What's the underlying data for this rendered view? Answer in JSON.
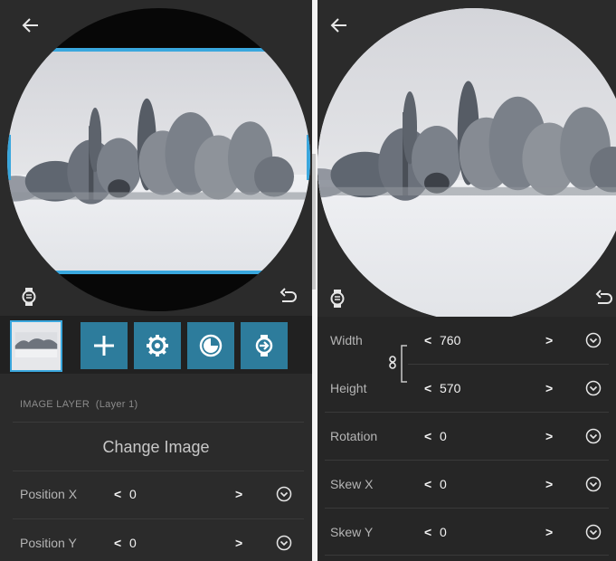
{
  "left": {
    "tools": [
      {
        "icon": "plus-icon"
      },
      {
        "icon": "gear-icon"
      },
      {
        "icon": "contrast-icon"
      },
      {
        "icon": "watch-import-icon"
      }
    ],
    "layer_title": "IMAGE LAYER",
    "layer_sub": "(Layer 1)",
    "change_image": "Change Image",
    "rows": [
      {
        "label": "Position X",
        "value": "0"
      },
      {
        "label": "Position Y",
        "value": "0"
      }
    ]
  },
  "right": {
    "rows": [
      {
        "label": "Width",
        "value": "760"
      },
      {
        "label": "Height",
        "value": "570"
      },
      {
        "label": "Rotation",
        "value": "0"
      },
      {
        "label": "Skew X",
        "value": "0"
      },
      {
        "label": "Skew Y",
        "value": "0"
      }
    ]
  },
  "colors": {
    "accent": "#39a7de",
    "tool_bg": "#2d7c9c",
    "panel_bg": "#2b2b2b"
  }
}
